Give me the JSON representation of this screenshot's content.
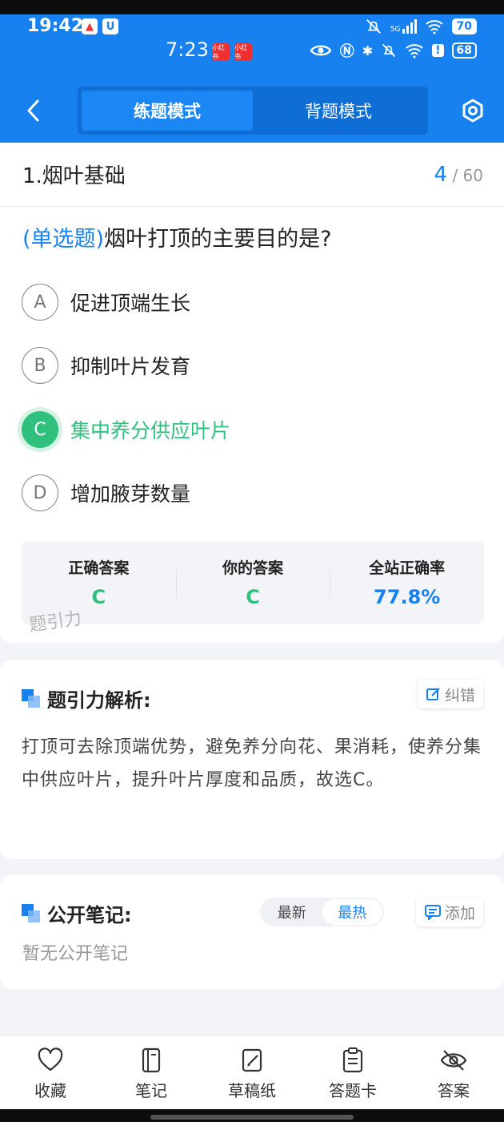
{
  "status_bar": {
    "time_primary": "19:42",
    "time_secondary": "7:23",
    "badge_red_label": "小红书",
    "battery_primary": "70",
    "battery_secondary": "68",
    "network_label": "5G"
  },
  "header": {
    "back_icon": "chevron-left-icon",
    "tabs": [
      {
        "label": "练题模式",
        "active": true
      },
      {
        "label": "背题模式",
        "active": false
      }
    ],
    "settings_icon": "hexagon-settings-icon"
  },
  "question": {
    "section": "1.烟叶基础",
    "current": "4",
    "total": "/ 60",
    "type": "(单选题)",
    "text": "烟叶打顶的主要目的是?",
    "options": [
      {
        "letter": "A",
        "text": "促进顶端生长",
        "state": "normal"
      },
      {
        "letter": "B",
        "text": "抑制叶片发育",
        "state": "normal"
      },
      {
        "letter": "C",
        "text": "集中养分供应叶片",
        "state": "correct"
      },
      {
        "letter": "D",
        "text": "增加腋芽数量",
        "state": "normal"
      }
    ]
  },
  "stats": {
    "correct_answer_label": "正确答案",
    "correct_answer_value": "C",
    "your_answer_label": "你的答案",
    "your_answer_value": "C",
    "accuracy_label": "全站正确率",
    "accuracy_value": "77.8%"
  },
  "watermark": "题引力",
  "analysis": {
    "title": "题引力解析:",
    "report_label": "纠错",
    "text": "打顶可去除顶端优势，避免养分向花、果消耗，使养分集中供应叶片，提升叶片厚度和品质，故选C。"
  },
  "notes": {
    "title": "公开笔记:",
    "sort_options": [
      {
        "label": "最新",
        "active": false
      },
      {
        "label": "最热",
        "active": true
      }
    ],
    "add_label": "添加",
    "empty_text": "暂无公开笔记"
  },
  "bottom_nav": [
    {
      "label": "收藏",
      "icon": "heart-icon"
    },
    {
      "label": "笔记",
      "icon": "notebook-icon"
    },
    {
      "label": "草稿纸",
      "icon": "draft-pad-icon"
    },
    {
      "label": "答题卡",
      "icon": "answer-sheet-icon"
    },
    {
      "label": "答案",
      "icon": "eye-off-icon"
    }
  ],
  "colors": {
    "brand_blue": "#1781f0",
    "correct_green": "#2fc07e"
  }
}
